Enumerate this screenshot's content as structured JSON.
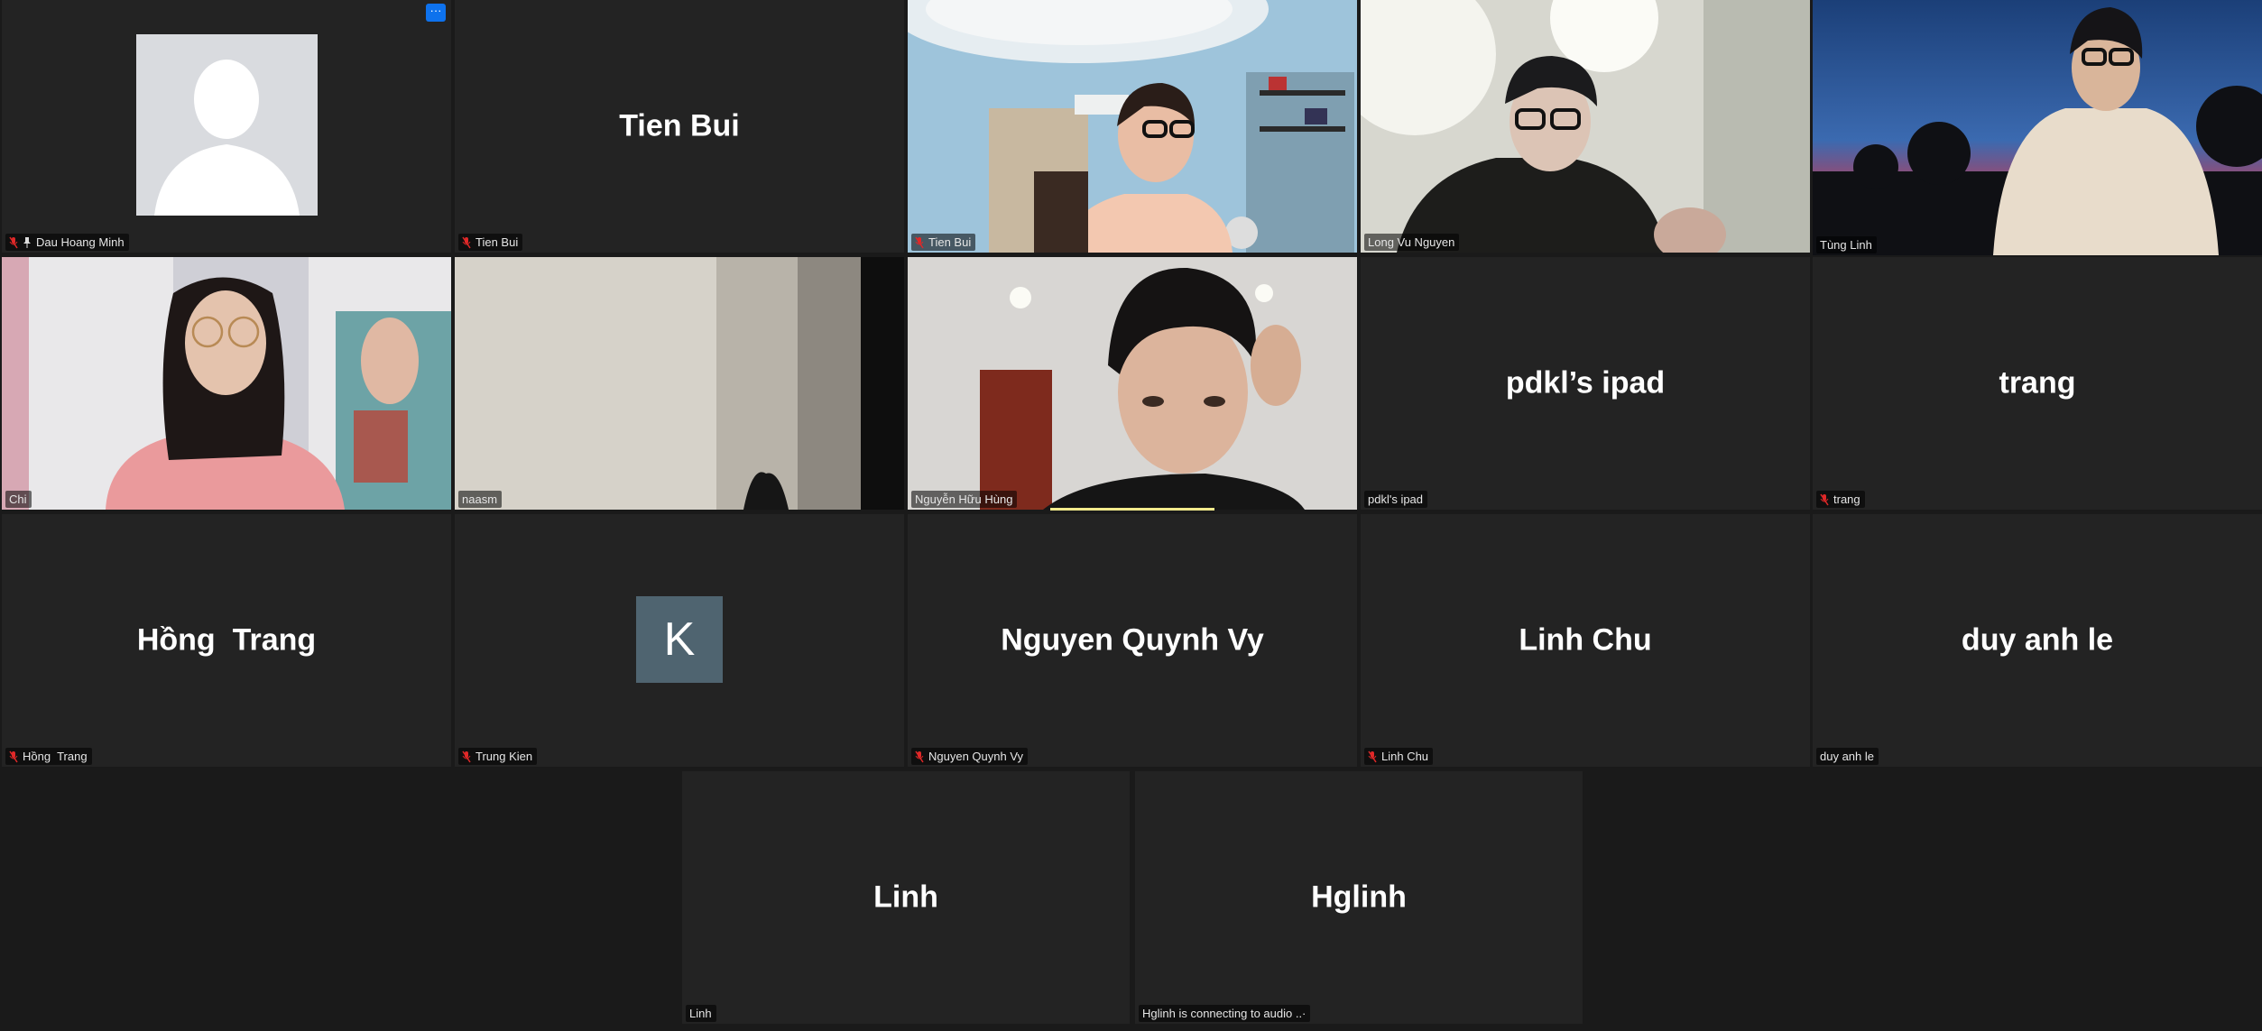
{
  "tiles": [
    {
      "center": "",
      "label": "Dau Hoang Minh",
      "muted": true,
      "pinned": true
    },
    {
      "center": "Tien Bui",
      "label": "Tien Bui",
      "muted": true
    },
    {
      "center": "",
      "label": "Tien Bui",
      "muted": true
    },
    {
      "center": "",
      "label": "Long Vu Nguyen",
      "muted": false
    },
    {
      "center": "",
      "label": "Tùng Linh",
      "muted": false,
      "speaking": true
    },
    {
      "center": "",
      "label": "Chi",
      "muted": false
    },
    {
      "center": "",
      "label": "naasm",
      "muted": false
    },
    {
      "center": "",
      "label": "Nguyễn Hữu Hùng",
      "muted": false
    },
    {
      "center": "pdkl’s ipad",
      "label": "pdkl's ipad",
      "muted": false
    },
    {
      "center": "trang",
      "label": "trang",
      "muted": true
    },
    {
      "center": "Hồng  Trang",
      "label": "Hồng  Trang",
      "muted": true
    },
    {
      "center": "K",
      "label": "Trung Kien",
      "muted": true
    },
    {
      "center": "Nguyen Quynh Vy",
      "label": "Nguyen Quynh Vy",
      "muted": true
    },
    {
      "center": "Linh Chu",
      "label": "Linh Chu",
      "muted": true
    },
    {
      "center": "duy anh le",
      "label": "duy anh le",
      "muted": false
    },
    {
      "center": "Linh",
      "label": "Linh",
      "muted": false
    },
    {
      "center": "Hglinh",
      "label": "Hglinh is connecting to audio ..·",
      "muted": false
    }
  ],
  "more_button": "···",
  "colors": {
    "muted_icon": "#e02828",
    "speaking_border": "#e8e07a",
    "button_blue": "#0e72ed"
  }
}
